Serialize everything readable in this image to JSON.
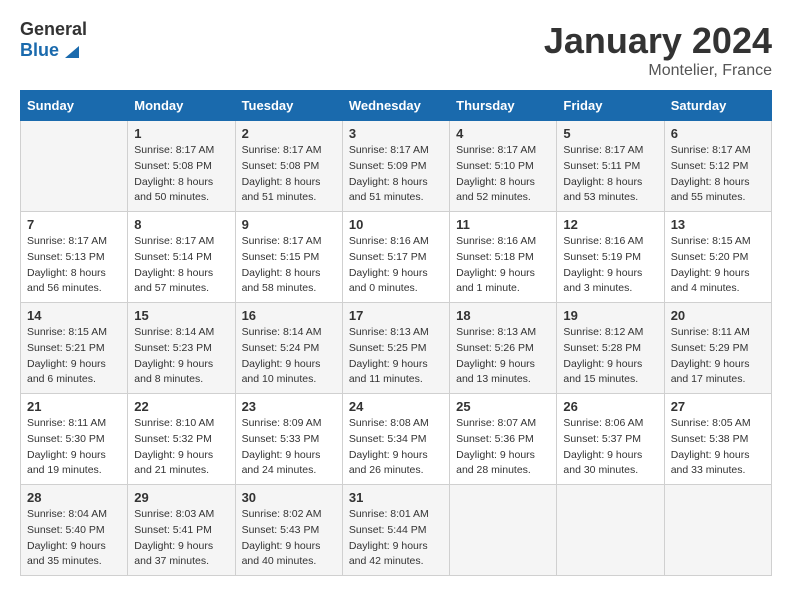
{
  "header": {
    "logo_general": "General",
    "logo_blue": "Blue",
    "title": "January 2024",
    "location": "Montelier, France"
  },
  "days_of_week": [
    "Sunday",
    "Monday",
    "Tuesday",
    "Wednesday",
    "Thursday",
    "Friday",
    "Saturday"
  ],
  "weeks": [
    [
      {
        "day": "",
        "sunrise": "",
        "sunset": "",
        "daylight": ""
      },
      {
        "day": "1",
        "sunrise": "Sunrise: 8:17 AM",
        "sunset": "Sunset: 5:08 PM",
        "daylight": "Daylight: 8 hours and 50 minutes."
      },
      {
        "day": "2",
        "sunrise": "Sunrise: 8:17 AM",
        "sunset": "Sunset: 5:08 PM",
        "daylight": "Daylight: 8 hours and 51 minutes."
      },
      {
        "day": "3",
        "sunrise": "Sunrise: 8:17 AM",
        "sunset": "Sunset: 5:09 PM",
        "daylight": "Daylight: 8 hours and 51 minutes."
      },
      {
        "day": "4",
        "sunrise": "Sunrise: 8:17 AM",
        "sunset": "Sunset: 5:10 PM",
        "daylight": "Daylight: 8 hours and 52 minutes."
      },
      {
        "day": "5",
        "sunrise": "Sunrise: 8:17 AM",
        "sunset": "Sunset: 5:11 PM",
        "daylight": "Daylight: 8 hours and 53 minutes."
      },
      {
        "day": "6",
        "sunrise": "Sunrise: 8:17 AM",
        "sunset": "Sunset: 5:12 PM",
        "daylight": "Daylight: 8 hours and 55 minutes."
      }
    ],
    [
      {
        "day": "7",
        "sunrise": "Sunrise: 8:17 AM",
        "sunset": "Sunset: 5:13 PM",
        "daylight": "Daylight: 8 hours and 56 minutes."
      },
      {
        "day": "8",
        "sunrise": "Sunrise: 8:17 AM",
        "sunset": "Sunset: 5:14 PM",
        "daylight": "Daylight: 8 hours and 57 minutes."
      },
      {
        "day": "9",
        "sunrise": "Sunrise: 8:17 AM",
        "sunset": "Sunset: 5:15 PM",
        "daylight": "Daylight: 8 hours and 58 minutes."
      },
      {
        "day": "10",
        "sunrise": "Sunrise: 8:16 AM",
        "sunset": "Sunset: 5:17 PM",
        "daylight": "Daylight: 9 hours and 0 minutes."
      },
      {
        "day": "11",
        "sunrise": "Sunrise: 8:16 AM",
        "sunset": "Sunset: 5:18 PM",
        "daylight": "Daylight: 9 hours and 1 minute."
      },
      {
        "day": "12",
        "sunrise": "Sunrise: 8:16 AM",
        "sunset": "Sunset: 5:19 PM",
        "daylight": "Daylight: 9 hours and 3 minutes."
      },
      {
        "day": "13",
        "sunrise": "Sunrise: 8:15 AM",
        "sunset": "Sunset: 5:20 PM",
        "daylight": "Daylight: 9 hours and 4 minutes."
      }
    ],
    [
      {
        "day": "14",
        "sunrise": "Sunrise: 8:15 AM",
        "sunset": "Sunset: 5:21 PM",
        "daylight": "Daylight: 9 hours and 6 minutes."
      },
      {
        "day": "15",
        "sunrise": "Sunrise: 8:14 AM",
        "sunset": "Sunset: 5:23 PM",
        "daylight": "Daylight: 9 hours and 8 minutes."
      },
      {
        "day": "16",
        "sunrise": "Sunrise: 8:14 AM",
        "sunset": "Sunset: 5:24 PM",
        "daylight": "Daylight: 9 hours and 10 minutes."
      },
      {
        "day": "17",
        "sunrise": "Sunrise: 8:13 AM",
        "sunset": "Sunset: 5:25 PM",
        "daylight": "Daylight: 9 hours and 11 minutes."
      },
      {
        "day": "18",
        "sunrise": "Sunrise: 8:13 AM",
        "sunset": "Sunset: 5:26 PM",
        "daylight": "Daylight: 9 hours and 13 minutes."
      },
      {
        "day": "19",
        "sunrise": "Sunrise: 8:12 AM",
        "sunset": "Sunset: 5:28 PM",
        "daylight": "Daylight: 9 hours and 15 minutes."
      },
      {
        "day": "20",
        "sunrise": "Sunrise: 8:11 AM",
        "sunset": "Sunset: 5:29 PM",
        "daylight": "Daylight: 9 hours and 17 minutes."
      }
    ],
    [
      {
        "day": "21",
        "sunrise": "Sunrise: 8:11 AM",
        "sunset": "Sunset: 5:30 PM",
        "daylight": "Daylight: 9 hours and 19 minutes."
      },
      {
        "day": "22",
        "sunrise": "Sunrise: 8:10 AM",
        "sunset": "Sunset: 5:32 PM",
        "daylight": "Daylight: 9 hours and 21 minutes."
      },
      {
        "day": "23",
        "sunrise": "Sunrise: 8:09 AM",
        "sunset": "Sunset: 5:33 PM",
        "daylight": "Daylight: 9 hours and 24 minutes."
      },
      {
        "day": "24",
        "sunrise": "Sunrise: 8:08 AM",
        "sunset": "Sunset: 5:34 PM",
        "daylight": "Daylight: 9 hours and 26 minutes."
      },
      {
        "day": "25",
        "sunrise": "Sunrise: 8:07 AM",
        "sunset": "Sunset: 5:36 PM",
        "daylight": "Daylight: 9 hours and 28 minutes."
      },
      {
        "day": "26",
        "sunrise": "Sunrise: 8:06 AM",
        "sunset": "Sunset: 5:37 PM",
        "daylight": "Daylight: 9 hours and 30 minutes."
      },
      {
        "day": "27",
        "sunrise": "Sunrise: 8:05 AM",
        "sunset": "Sunset: 5:38 PM",
        "daylight": "Daylight: 9 hours and 33 minutes."
      }
    ],
    [
      {
        "day": "28",
        "sunrise": "Sunrise: 8:04 AM",
        "sunset": "Sunset: 5:40 PM",
        "daylight": "Daylight: 9 hours and 35 minutes."
      },
      {
        "day": "29",
        "sunrise": "Sunrise: 8:03 AM",
        "sunset": "Sunset: 5:41 PM",
        "daylight": "Daylight: 9 hours and 37 minutes."
      },
      {
        "day": "30",
        "sunrise": "Sunrise: 8:02 AM",
        "sunset": "Sunset: 5:43 PM",
        "daylight": "Daylight: 9 hours and 40 minutes."
      },
      {
        "day": "31",
        "sunrise": "Sunrise: 8:01 AM",
        "sunset": "Sunset: 5:44 PM",
        "daylight": "Daylight: 9 hours and 42 minutes."
      },
      {
        "day": "",
        "sunrise": "",
        "sunset": "",
        "daylight": ""
      },
      {
        "day": "",
        "sunrise": "",
        "sunset": "",
        "daylight": ""
      },
      {
        "day": "",
        "sunrise": "",
        "sunset": "",
        "daylight": ""
      }
    ]
  ]
}
